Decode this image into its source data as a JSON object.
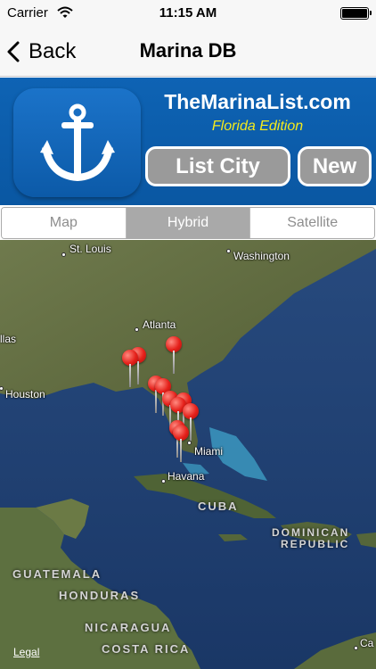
{
  "status_bar": {
    "carrier": "Carrier",
    "time": "11:15 AM",
    "icons": [
      "wifi-icon",
      "battery-icon"
    ]
  },
  "nav": {
    "back_label": "Back",
    "title": "Marina DB"
  },
  "banner": {
    "site_name": "TheMarinaList.com",
    "edition": "Florida Edition",
    "list_city_label": "List City",
    "new_label": "New",
    "icon": "anchor-icon",
    "colors": {
      "background": "#0e63b4",
      "edition_text": "#f5ea1b",
      "button_fill": "#9a9a9a"
    }
  },
  "map_type": {
    "options": [
      "Map",
      "Hybrid",
      "Satellite"
    ],
    "selected": "Hybrid"
  },
  "map": {
    "cities": [
      "St. Louis",
      "Washington",
      "Atlanta",
      "llas",
      "Houston",
      "Miami",
      "Havana"
    ],
    "countries": [
      "CUBA",
      "DOMINICAN",
      "REPUBLIC",
      "GUATEMALA",
      "HONDURAS",
      "NICARAGUA",
      "COSTA RICA",
      "Ca"
    ],
    "legal_label": "Legal",
    "marker_count": 11
  }
}
